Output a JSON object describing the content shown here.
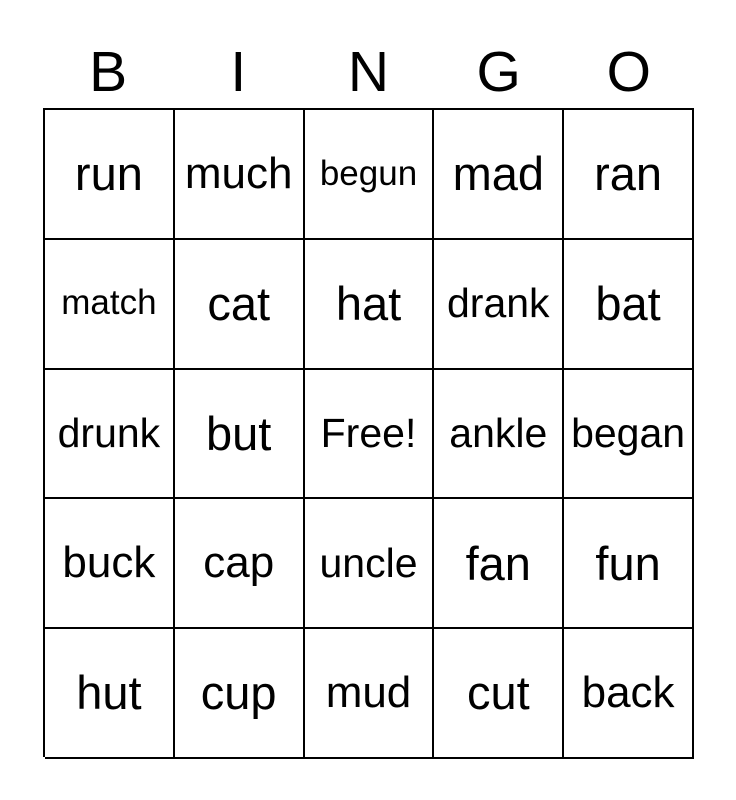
{
  "card": {
    "type": "bingo-card",
    "columns": 5,
    "rows": 5,
    "background_color": "#ffffff",
    "border_color": "#000000",
    "text_color": "#000000"
  },
  "header": {
    "letters": [
      "B",
      "I",
      "N",
      "G",
      "O"
    ]
  },
  "grid": {
    "rows": [
      {
        "cells": [
          {
            "text": "run",
            "size": "fs-xl",
            "free": false
          },
          {
            "text": "much",
            "size": "fs-lg",
            "free": false
          },
          {
            "text": "begun",
            "size": "fs-sm",
            "free": false
          },
          {
            "text": "mad",
            "size": "fs-xl",
            "free": false
          },
          {
            "text": "ran",
            "size": "fs-xl",
            "free": false
          }
        ]
      },
      {
        "cells": [
          {
            "text": "match",
            "size": "fs-sm",
            "free": false
          },
          {
            "text": "cat",
            "size": "fs-xl",
            "free": false
          },
          {
            "text": "hat",
            "size": "fs-xl",
            "free": false
          },
          {
            "text": "drank",
            "size": "fs-md",
            "free": false
          },
          {
            "text": "bat",
            "size": "fs-xl",
            "free": false
          }
        ]
      },
      {
        "cells": [
          {
            "text": "drunk",
            "size": "fs-md",
            "free": false
          },
          {
            "text": "but",
            "size": "fs-xl",
            "free": false
          },
          {
            "text": "Free!",
            "size": "fs-md",
            "free": true
          },
          {
            "text": "ankle",
            "size": "fs-md",
            "free": false
          },
          {
            "text": "began",
            "size": "fs-md",
            "free": false
          }
        ]
      },
      {
        "cells": [
          {
            "text": "buck",
            "size": "fs-lg",
            "free": false
          },
          {
            "text": "cap",
            "size": "fs-lg",
            "free": false
          },
          {
            "text": "uncle",
            "size": "fs-md",
            "free": false
          },
          {
            "text": "fan",
            "size": "fs-xl",
            "free": false
          },
          {
            "text": "fun",
            "size": "fs-xl",
            "free": false
          }
        ]
      },
      {
        "cells": [
          {
            "text": "hut",
            "size": "fs-xl",
            "free": false
          },
          {
            "text": "cup",
            "size": "fs-xl",
            "free": false
          },
          {
            "text": "mud",
            "size": "fs-lg",
            "free": false
          },
          {
            "text": "cut",
            "size": "fs-xl",
            "free": false
          },
          {
            "text": "back",
            "size": "fs-lg",
            "free": false
          }
        ]
      }
    ]
  }
}
